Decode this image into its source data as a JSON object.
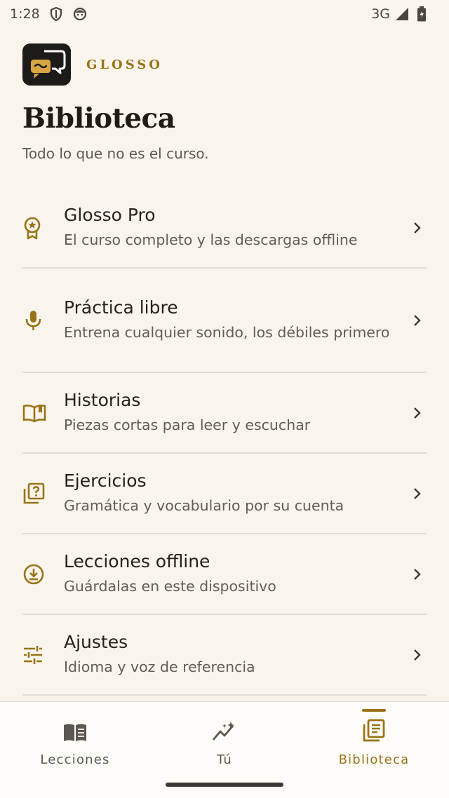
{
  "status_bar": {
    "time": "1:28",
    "network": "3G",
    "icons": [
      "shield-icon",
      "face-icon",
      "signal-icon",
      "battery-icon"
    ]
  },
  "brand": {
    "name": "GLOSSO",
    "logo_icon": "chat-bubbles-logo"
  },
  "page": {
    "title": "Biblioteca",
    "subtitle": "Todo lo que no es el curso."
  },
  "menu": {
    "items": [
      {
        "icon": "award-icon",
        "title": "Glosso Pro",
        "description": "El curso completo y las descargas offline"
      },
      {
        "icon": "microphone-icon",
        "title": "Práctica libre",
        "description": "Entrena cualquier sonido, los débiles primero"
      },
      {
        "icon": "open-book-icon",
        "title": "Historias",
        "description": "Piezas cortas para leer y escuchar"
      },
      {
        "icon": "quiz-icon",
        "title": "Ejercicios",
        "description": "Gramática y vocabulario por su cuenta"
      },
      {
        "icon": "download-icon",
        "title": "Lecciones offline",
        "description": "Guárdalas en este dispositivo"
      },
      {
        "icon": "sliders-icon",
        "title": "Ajustes",
        "description": "Idioma y voz de referencia"
      }
    ]
  },
  "bottom_nav": {
    "items": [
      {
        "icon": "book-icon",
        "label": "Lecciones",
        "active": false
      },
      {
        "icon": "sparkline-icon",
        "label": "Tú",
        "active": false
      },
      {
        "icon": "library-icon",
        "label": "Biblioteca",
        "active": true
      }
    ]
  },
  "colors": {
    "background": "#f9f5ec",
    "accent": "#9a7318",
    "divider": "#e2ddd1",
    "nav_background": "#fdfcf9"
  }
}
